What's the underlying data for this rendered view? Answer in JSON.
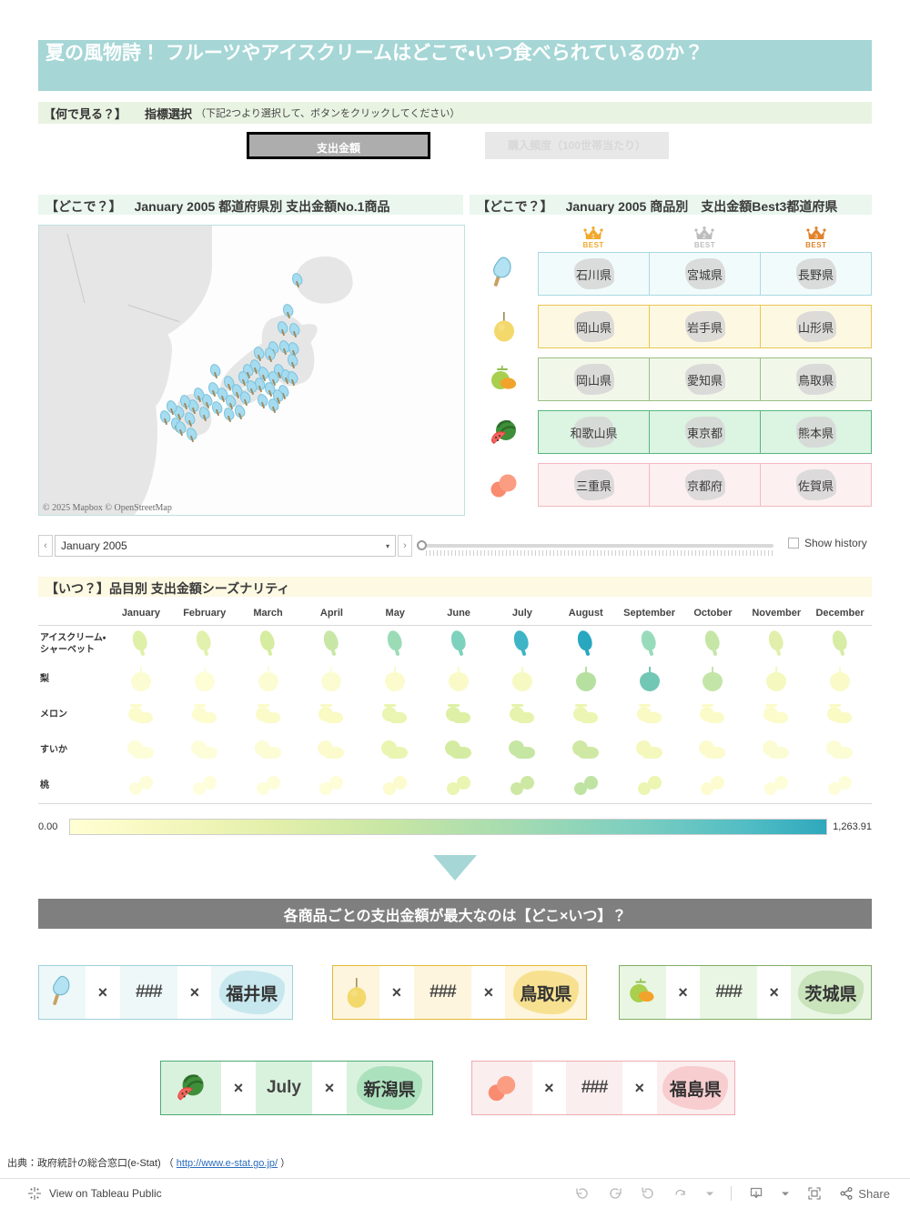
{
  "title": "夏の風物詩！ フルーツやアイスクリームはどこで・いつ食べられているのか？",
  "metric_selector": {
    "label_what": "【何で見る？】",
    "label_select": "指標選択",
    "hint": "（下記2つより選択して、ボタンをクリックしてください）",
    "buttons": [
      {
        "label": "支出金額",
        "selected": true
      },
      {
        "label": "購入頻度（100世帯当たり）",
        "selected": false
      }
    ]
  },
  "map_panel": {
    "prefix": "【どこで？】",
    "title": "January 2005 都道府県別 支出金額No.1商品",
    "credit": "© 2025 Mapbox © OpenStreetMap"
  },
  "best_panel": {
    "prefix": "【どこで？】",
    "title": "January 2005 商品別　支出金額Best3都道府県",
    "rank_labels": [
      "BEST",
      "BEST",
      "BEST"
    ],
    "rank_numbers": [
      "1",
      "2",
      "3"
    ],
    "rank_colors": [
      "#f0a92e",
      "#bdbdbd",
      "#e0832b"
    ],
    "rows": [
      {
        "item": "アイスクリーム・シャーベット",
        "icon": "ice-cream-bar-icon",
        "bg": "#f2fbfb",
        "border": "#a9d9e2",
        "prefectures": [
          "石川県",
          "宮城県",
          "長野県"
        ]
      },
      {
        "item": "梨",
        "icon": "pear-icon",
        "bg": "#fdf8e2",
        "border": "#e8c653",
        "prefectures": [
          "岡山県",
          "岩手県",
          "山形県"
        ]
      },
      {
        "item": "メロン",
        "icon": "melon-icon",
        "bg": "#f1f8ea",
        "border": "#9dbd84",
        "prefectures": [
          "岡山県",
          "愛知県",
          "鳥取県"
        ]
      },
      {
        "item": "すいか",
        "icon": "watermelon-icon",
        "bg": "#dcf4e2",
        "border": "#57b77f",
        "prefectures": [
          "和歌山県",
          "東京都",
          "熊本県"
        ]
      },
      {
        "item": "桃",
        "icon": "peach-icon",
        "bg": "#fdf0f0",
        "border": "#f3b9bf",
        "prefectures": [
          "三重県",
          "京都府",
          "佐賀県"
        ]
      }
    ]
  },
  "date_control": {
    "prev_label": "‹",
    "next_label": "›",
    "selected": "January 2005",
    "caret": "▾",
    "show_history_label": "Show history",
    "show_history_checked": false
  },
  "season_panel": {
    "prefix": "【いつ？】",
    "title": "品目別 支出金額シーズナリティ"
  },
  "legend": {
    "min": "0.00",
    "max": "1,263.91"
  },
  "banner": {
    "text": "各商品ごとの支出金額が最大なのは【どこ×いつ】？"
  },
  "max_cards": [
    {
      "icon": "ice-cream-bar-icon",
      "x": "×",
      "month": "###",
      "prefecture": "福井県",
      "bg": "#eef8f9",
      "border": "#9fd0da",
      "shape": "#a8d9e6"
    },
    {
      "icon": "pear-icon",
      "x": "×",
      "month": "###",
      "prefecture": "鳥取県",
      "bg": "#fdf5dd",
      "border": "#e3b838",
      "shape": "#f2cf52"
    },
    {
      "icon": "melon-icon",
      "x": "×",
      "month": "###",
      "prefecture": "茨城県",
      "bg": "#e9f6e3",
      "border": "#7fae67",
      "shape": "#aed49a"
    },
    {
      "icon": "watermelon-icon",
      "x": "×",
      "month": "July",
      "prefecture": "新潟県",
      "bg": "#d9f2de",
      "border": "#4faa76",
      "shape": "#86d3a2"
    },
    {
      "icon": "peach-icon",
      "x": "×",
      "month": "###",
      "prefecture": "福島県",
      "bg": "#fbeeee",
      "border": "#eeaab2",
      "shape": "#f5b2b8"
    }
  ],
  "source": {
    "prefix": "出典：政府統計の総合窓口(e-Stat) （ ",
    "link": "http://www.e-stat.go.jp/",
    "suffix": " ）"
  },
  "toolbar": {
    "view_label": "View on Tableau Public",
    "share_label": "Share",
    "icons": [
      "undo-icon",
      "redo-icon",
      "revert-icon",
      "refresh-icon",
      "caret-down-icon",
      "download-icon",
      "fullscreen-icon",
      "share-icon"
    ]
  },
  "chart_data": {
    "type": "heatmap",
    "title": "品目別 支出金額シーズナリティ",
    "xlabel": "",
    "ylabel": "",
    "categories": [
      "January",
      "February",
      "March",
      "April",
      "May",
      "June",
      "July",
      "August",
      "September",
      "October",
      "November",
      "December"
    ],
    "rows": [
      "アイスクリーム・シャーベット",
      "梨",
      "メロン",
      "すいか",
      "桃"
    ],
    "row_icons": [
      "ice-cream-bar-icon",
      "pear-icon",
      "melon-icon",
      "watermelon-icon",
      "peach-icon"
    ],
    "colorbar": {
      "min": 0.0,
      "max": 1263.91,
      "label_min": "0.00",
      "label_max": "1,263.91",
      "scale": [
        "#ffffd4",
        "#eef5b0",
        "#c9e6a4",
        "#90d7b4",
        "#4fbcc4",
        "#2fa8bd"
      ]
    },
    "series": [
      {
        "name": "アイスクリーム・シャーベット",
        "values": [
          430,
          420,
          470,
          500,
          700,
          860,
          1180,
          1264,
          760,
          560,
          470,
          500
        ],
        "colors": [
          "#dff0a8",
          "#e2f1ad",
          "#d6ecA0",
          "#c8e7a6",
          "#9bdcb6",
          "#7ed2bd",
          "#3fb4c6",
          "#29a7c0",
          "#97dbba",
          "#c6e6a6",
          "#e0f0ac",
          "#d7ecA4"
        ]
      },
      {
        "name": "梨",
        "values": [
          60,
          55,
          60,
          60,
          70,
          95,
          150,
          620,
          880,
          400,
          150,
          80
        ],
        "colors": [
          "#fcfcd2",
          "#fdfdd6",
          "#fcfcd2",
          "#fcfcd2",
          "#fbfbcd",
          "#fafac8",
          "#f7f9c2",
          "#b5e0a0",
          "#71c7b4",
          "#c3e5a8",
          "#f5f8bf",
          "#fafac9"
        ]
      },
      {
        "name": "メロン",
        "values": [
          80,
          75,
          85,
          110,
          260,
          420,
          290,
          230,
          110,
          95,
          90,
          110
        ],
        "colors": [
          "#fbfbcb",
          "#fcfccf",
          "#fbfbc9",
          "#f9fac4",
          "#e9f5b0",
          "#ddf0a6",
          "#e6f3ac",
          "#ecf5b2",
          "#f9fac4",
          "#fbfbc9",
          "#fbfbcb",
          "#f9fac4"
        ]
      },
      {
        "name": "すいか",
        "values": [
          40,
          35,
          45,
          70,
          250,
          520,
          700,
          560,
          170,
          70,
          50,
          45
        ],
        "colors": [
          "#fdfdd8",
          "#fdfdda",
          "#fcfcd5",
          "#fbfbcd",
          "#eaf5b1",
          "#d4ecA2",
          "#c6e6a3",
          "#cfe9a4",
          "#f4f8bd",
          "#fbfbcd",
          "#fcfcd4",
          "#fcfcd5"
        ]
      },
      {
        "name": "桃",
        "values": [
          20,
          18,
          20,
          25,
          60,
          230,
          520,
          600,
          210,
          50,
          25,
          20
        ],
        "colors": [
          "#fdfdda",
          "#fefedc",
          "#fdfdda",
          "#fdfdd8",
          "#fbfbcd",
          "#eaf5b1",
          "#cde8a3",
          "#bfe3a3",
          "#ecf5b2",
          "#fcfcd0",
          "#fdfdd8",
          "#fdfdda"
        ]
      }
    ]
  }
}
